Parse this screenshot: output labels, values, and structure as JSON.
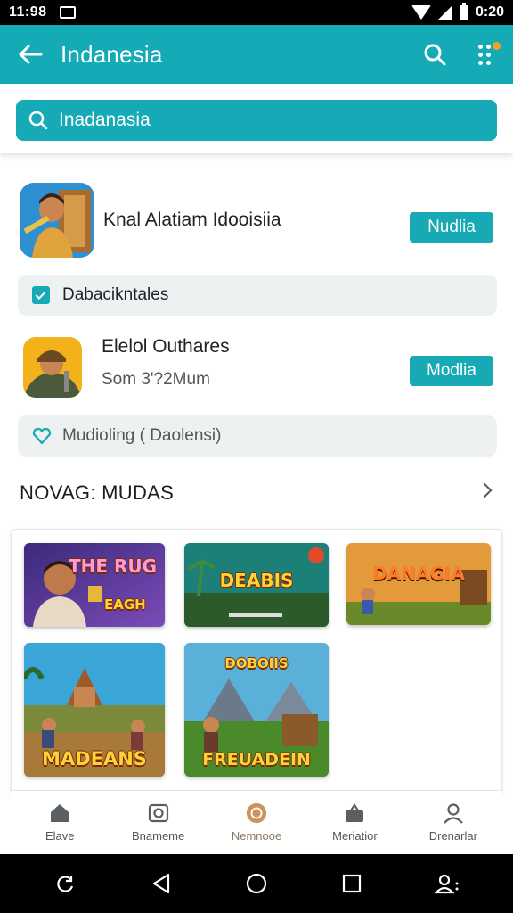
{
  "status_bar": {
    "time": "11:98",
    "clock_right": "0:20"
  },
  "app_bar": {
    "title": "Indanesia"
  },
  "search": {
    "value": "Inadanasia"
  },
  "apps": [
    {
      "name": "Knal Alatiam Idooisiia",
      "action": "Nudlia"
    },
    {
      "name": "Elelol Outhares",
      "subtitle": "Som 3'?2Mum",
      "action": "Modlia"
    }
  ],
  "chips": [
    {
      "label": "Dabacikntales",
      "icon": "checkbox-icon"
    },
    {
      "label": "Mudioling ( Daolensi)",
      "icon": "heart-outline-icon"
    }
  ],
  "section": {
    "title": "NOVAG: MUDAS"
  },
  "tiles": [
    {
      "title": "THE RUG",
      "subtitle": "EAGH"
    },
    {
      "title": "DEABIS",
      "subtitle": ""
    },
    {
      "title": "DANAGIA",
      "subtitle": ""
    },
    {
      "title": "MADEANS",
      "subtitle": ""
    },
    {
      "title": "FREUADEIN",
      "subtitle": "DOBOIIS"
    }
  ],
  "bottom_nav": [
    {
      "label": "Elave",
      "icon": "home-icon"
    },
    {
      "label": "Bnameme",
      "icon": "camera-icon"
    },
    {
      "label": "Nemnooe",
      "icon": "circle-icon"
    },
    {
      "label": "Meriatior",
      "icon": "bag-icon"
    },
    {
      "label": "Drenarlar",
      "icon": "person-icon"
    }
  ],
  "colors": {
    "accent": "#14aab6",
    "chip_bg": "#eef1f2",
    "active_nav": "#c9955a"
  }
}
